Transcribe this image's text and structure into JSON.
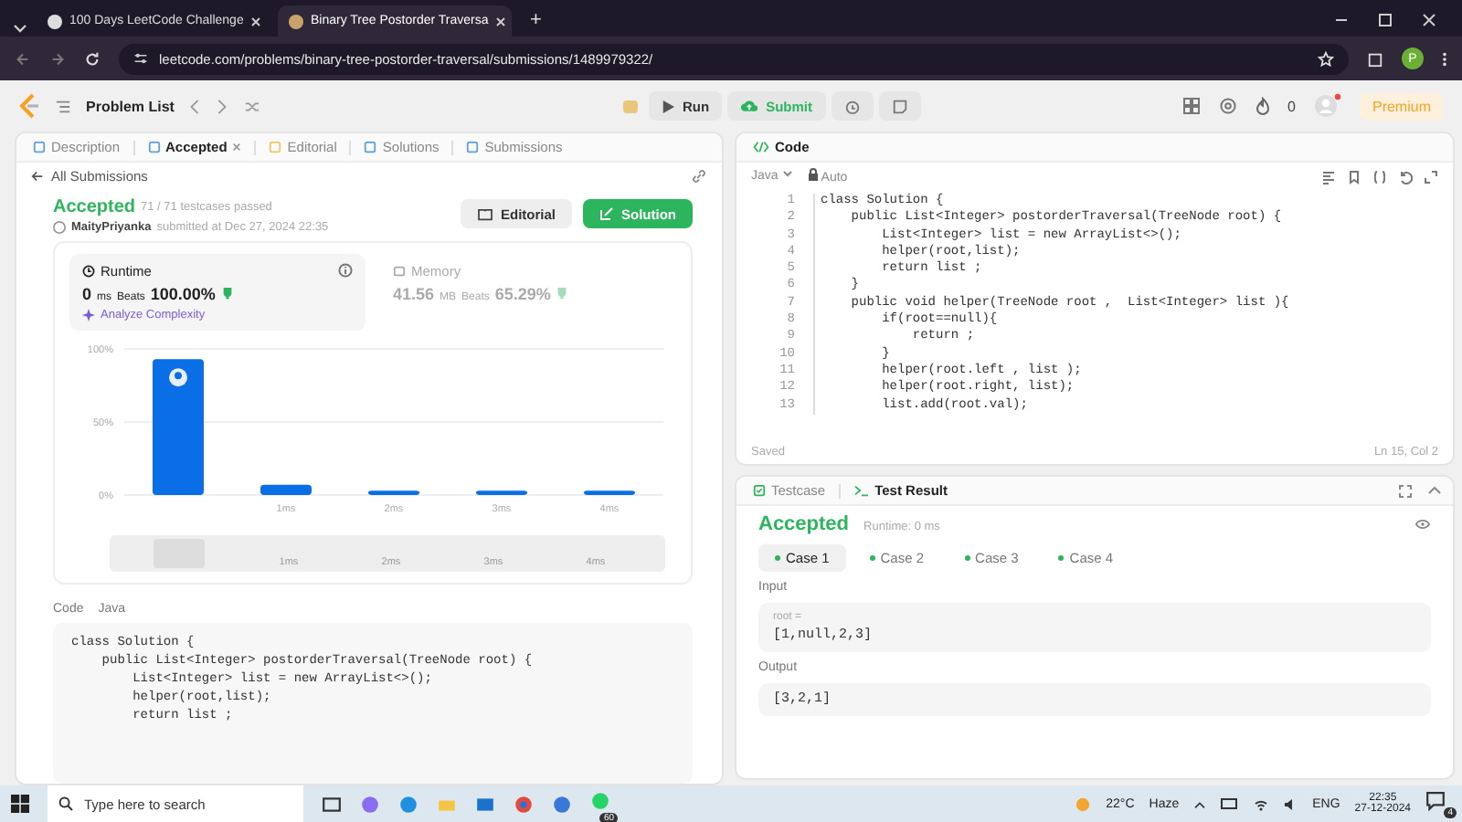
{
  "browser": {
    "tabs": [
      {
        "title": "100 Days LeetCode Challenge",
        "selected": false
      },
      {
        "title": "Binary Tree Postorder Traversa",
        "selected": true
      }
    ],
    "new_tab": "+",
    "url": "leetcode.com/problems/binary-tree-postorder-traversal/submissions/1489979322/",
    "profile_initial": "P"
  },
  "nav": {
    "problem_list": "Problem List",
    "run": "Run",
    "submit": "Submit",
    "streak": "0",
    "premium": "Premium"
  },
  "left_panel": {
    "tabs": [
      {
        "label": "Description",
        "selected": false,
        "closable": false
      },
      {
        "label": "Accepted",
        "selected": true,
        "closable": true
      },
      {
        "label": "Editorial",
        "selected": false,
        "closable": false
      },
      {
        "label": "Solutions",
        "selected": false,
        "closable": false
      },
      {
        "label": "Submissions",
        "selected": false,
        "closable": false
      }
    ],
    "back_link": "All Submissions",
    "submission": {
      "status": "Accepted",
      "testcases": "71 / 71 testcases passed",
      "user": "MaityPriyanka",
      "submitted": "submitted at Dec 27, 2024 22:35",
      "editorial": "Editorial",
      "solution": "Solution"
    },
    "stats": [
      {
        "kind": "runtime",
        "label": "Runtime",
        "value": "0",
        "unit": "ms",
        "beats_label": "Beats",
        "beats": "100.00%",
        "analyze": "Analyze Complexity",
        "selected": true
      },
      {
        "kind": "memory",
        "label": "Memory",
        "value": "41.56",
        "unit": "MB",
        "beats_label": "Beats",
        "beats": "65.29%",
        "selected": false
      }
    ],
    "chart_data": {
      "type": "bar",
      "categories": [
        null,
        "1ms",
        "2ms",
        "3ms",
        "4ms"
      ],
      "values": [
        93,
        7,
        3,
        3,
        3
      ],
      "ylim": [
        0,
        100
      ],
      "yticks": [
        {
          "value": 0,
          "label": "0%"
        },
        {
          "value": 50,
          "label": "50%"
        },
        {
          "value": 100,
          "label": "100%"
        }
      ]
    },
    "range_slider": {
      "labels": [
        "1ms",
        "2ms",
        "3ms",
        "4ms"
      ],
      "level": 0.08
    },
    "code_label": "Code",
    "code_language": "Java",
    "code_lines": [
      "class Solution {",
      "    public List<Integer> postorderTraversal(TreeNode root) {",
      "        List<Integer> list = new ArrayList<>();",
      "        helper(root,list);",
      "        return list ;"
    ]
  },
  "code_panel": {
    "title": "Code",
    "language": "Java",
    "mode": "Auto",
    "lines": [
      {
        "number": "1",
        "text": "class Solution {"
      },
      {
        "number": "2",
        "text": "    public List<Integer> postorderTraversal(TreeNode root) {"
      },
      {
        "number": "3",
        "text": "        List<Integer> list = new ArrayList<>();"
      },
      {
        "number": "4",
        "text": "        helper(root,list);"
      },
      {
        "number": "5",
        "text": "        return list ;"
      },
      {
        "number": "6",
        "text": "    }"
      },
      {
        "number": "7",
        "text": "    public void helper(TreeNode root ,  List<Integer> list ){"
      },
      {
        "number": "8",
        "text": "        if(root==null){"
      },
      {
        "number": "9",
        "text": "            return ;"
      },
      {
        "number": "10",
        "text": "        }"
      },
      {
        "number": "11",
        "text": "        helper(root.left , list );"
      },
      {
        "number": "12",
        "text": "        helper(root.right, list);"
      },
      {
        "number": "13",
        "text": "        list.add(root.val);"
      }
    ],
    "status": "Saved",
    "cursor": "Ln 15, Col 2"
  },
  "test_panel": {
    "tabs": [
      {
        "label": "Testcase",
        "selected": false
      },
      {
        "label": "Test Result",
        "selected": true
      }
    ],
    "status": "Accepted",
    "runtime": "Runtime: 0 ms",
    "cases": [
      {
        "label": "Case 1",
        "selected": true
      },
      {
        "label": "Case 2",
        "selected": false
      },
      {
        "label": "Case 3",
        "selected": false
      },
      {
        "label": "Case 4",
        "selected": false
      }
    ],
    "input_label": "Input",
    "inputs": [
      {
        "name": "root =",
        "value": "[1,null,2,3]"
      }
    ],
    "output_label": "Output",
    "output": "[3,2,1]"
  },
  "taskbar": {
    "search_placeholder": "Type here to search",
    "whatsapp_badge": "60",
    "temperature": "22°C",
    "condition": "Haze",
    "language": "ENG",
    "time": "22:35",
    "date": "27-12-2024",
    "notifications": "4"
  }
}
